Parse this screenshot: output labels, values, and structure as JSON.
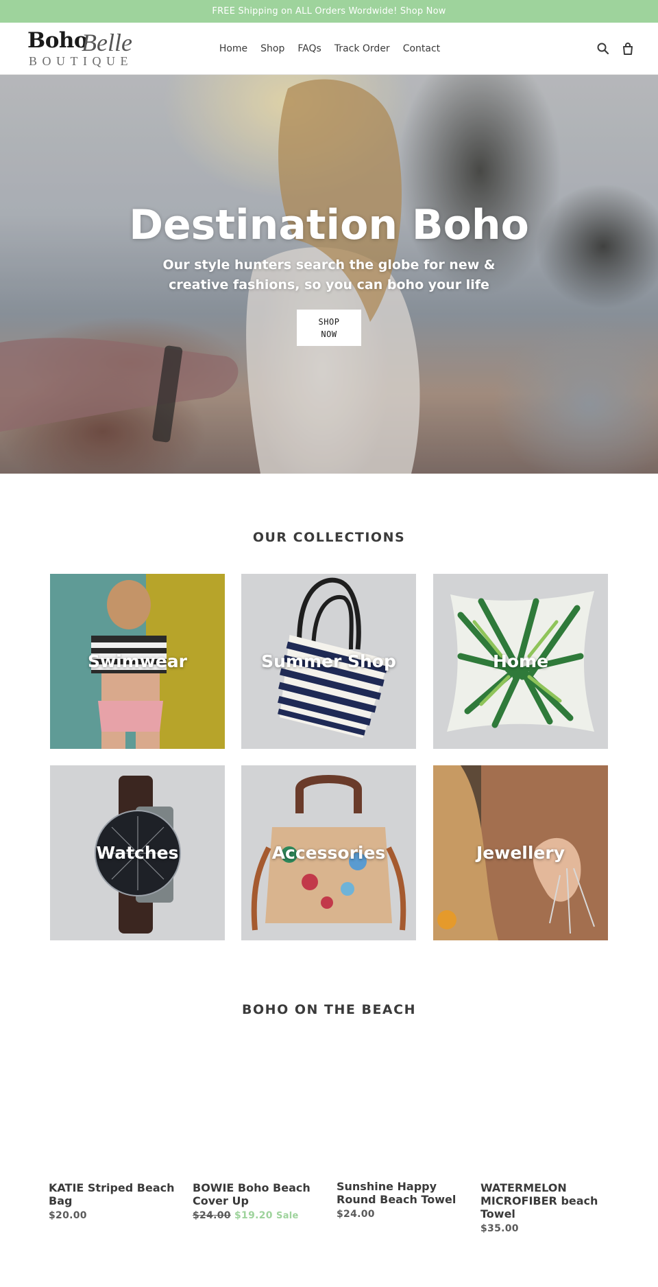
{
  "announcement": {
    "text": "FREE Shipping on ALL Orders Wordwide! Shop Now"
  },
  "header": {
    "logo": {
      "line1": "Boho",
      "line2": "Belle",
      "line3": "BOUTIQUE"
    },
    "nav": [
      "Home",
      "Shop",
      "FAQs",
      "Track Order",
      "Contact"
    ],
    "icons": [
      "search-icon",
      "cart-icon"
    ]
  },
  "hero": {
    "title": "Destination Boho",
    "subtitle": "Our style hunters search the globe for new & creative fashions, so you can boho your life",
    "button": "SHOP NOW"
  },
  "collections": {
    "heading": "OUR COLLECTIONS",
    "items": [
      {
        "title": "Swimwear"
      },
      {
        "title": "Summer Shop"
      },
      {
        "title": "Home"
      },
      {
        "title": "Watches"
      },
      {
        "title": "Accessories"
      },
      {
        "title": "Jewellery"
      }
    ]
  },
  "featured": {
    "heading": "BOHO ON THE BEACH",
    "products": [
      {
        "title": "KATIE Striped Beach Bag",
        "price": "$20.00"
      },
      {
        "title": "BOWIE Boho Beach Cover Up",
        "old_price": "$24.00",
        "sale_price": "$19.20",
        "sale_label": "Sale"
      },
      {
        "title": "Sunshine Happy Round Beach Towel",
        "price": "$24.00"
      },
      {
        "title": "WATERMELON MICROFIBER beach Towel",
        "price": "$35.00"
      }
    ]
  },
  "colors": {
    "accent": "#9ed39c",
    "text": "#3a3a3a",
    "tile_bg": "#d2d3d5"
  }
}
